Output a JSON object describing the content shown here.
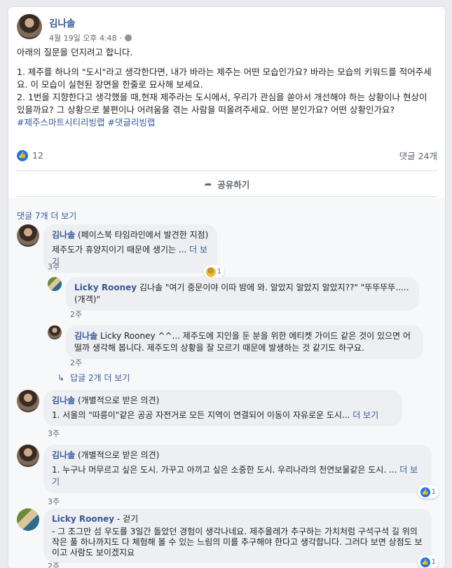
{
  "post": {
    "author": "김나솔",
    "timestamp": "4월 19일 오후 4:48",
    "visibility_icon": "globe-icon",
    "intro": "아래의 질문을 던지려고 합니다.",
    "q1": "1. 제주를 하나의 \"도시\"라고 생각한다면, 내가 바라는 제주는 어떤 모습인가요? 바라는 모습의 키워드를 적어주세요. 이 모습이 실현된 장면을 한줄로 묘사해 보세요.",
    "q2": "2. 1번을 지향한다고 생각했을 때,현재 제주라는 도시에서, 우리가 관심을 쏟아서 개선해야 하는 상황이나 현상이 있을까요? 그 상황으로 불편이나 어려움을 겪는 사람을 떠올려주세요. 어떤 분인가요? 어떤 상황인가요?",
    "hashtags": "#제주스마트시티리빙랩 #댓글리빙랩"
  },
  "stats": {
    "likes": "12",
    "comments": "댓글 24개"
  },
  "share_label": "공유하기",
  "more_comments": "댓글 7개 더 보기",
  "comments": [
    {
      "author": "김나솔",
      "sub": "(페이스북 타임라인에서 발견한 지점)",
      "text": "제주도가 휴양지이기 때문에 생기는 ... ",
      "see_more": "더 보기",
      "reaction_count": "1",
      "time": "3주"
    },
    {
      "author": "Licky Rooney",
      "text": "김나솔 \"여기 중문이야 이따 밤에 와. 알았지 알았지 알았지??\" \"뚜뚜뚜뚜.....(개객)\"",
      "time": "2주"
    },
    {
      "author": "김나솔",
      "text": "Licky Rooney ^^... 제주도에 지인을 둔 분을 위한 에티켓 가이드 같은 것이 있으면 어떨까 생각해 봅니다. 제주도의 상황을 잘 모르기 때문에 발생하는 것 같기도 하구요.",
      "time": "2주"
    },
    {
      "author": "김나솔",
      "sub": "(개별적으로 받은 의견)",
      "text": "1. 서울의 \"따릉이\"같은 공공 자전거로 모든 지역이 연결되어 이동이 자유로운 도시... ",
      "see_more": "더 보기",
      "time": "3주"
    },
    {
      "author": "김나솔",
      "sub": "(개별적으로 받은 의견)",
      "text": "1. 누구나 머무르고 싶은 도시. 가꾸고 아끼고 싶은 소중한 도시. 우리나라의 천연보물같은 도시. ... ",
      "see_more": "더 보기",
      "reaction_count": "1",
      "time": "3주"
    },
    {
      "author": "Licky Rooney",
      "sub": "- 걷기",
      "text": "- 그 조그만 섬 우도를 3일간 돌았던 경험이 생각나네요. 제주올레가 추구하는 가치처럼 구석구석 길 위의 작은 풀 하나까지도 다 체험해 볼 수 있는 느림의 미를 추구해야 한다고 생각합니다. 그러다 보면 상점도 보이고 사람도 보이겠지요",
      "reaction_count": "1",
      "time": "2주"
    }
  ],
  "replies_link": "답글 2개 더 보기"
}
